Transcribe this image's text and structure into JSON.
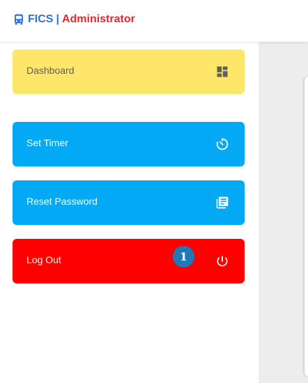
{
  "header": {
    "brand_icon": "bus-icon",
    "brand_name": "FICS",
    "separator": "|",
    "role": "Administrator"
  },
  "sidebar": {
    "items": [
      {
        "label": "Dashboard",
        "icon": "dashboard-icon",
        "color": "#fde66a"
      },
      {
        "label": "Set Timer",
        "icon": "timer-icon",
        "color": "#03a9f4"
      },
      {
        "label": "Reset Password",
        "icon": "library-books-icon",
        "color": "#03a9f4"
      },
      {
        "label": "Log Out",
        "icon": "power-icon",
        "color": "#ff0000"
      }
    ]
  },
  "badge": {
    "value": "1",
    "color": "#1f78b8"
  },
  "colors": {
    "brand_blue": "#2f6fde",
    "brand_red": "#e8262b",
    "content_background": "#ededed"
  }
}
